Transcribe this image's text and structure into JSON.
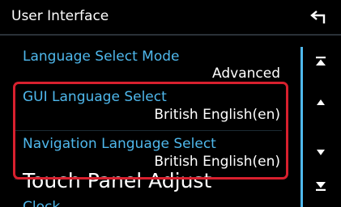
{
  "header": {
    "title": "User Interface",
    "back_icon": "return-arrow-icon"
  },
  "list": {
    "items": [
      {
        "label": "Language Select Mode",
        "value": "Advanced"
      },
      {
        "label": "GUI Language Select",
        "value": "British English(en)"
      },
      {
        "label": "Navigation Language Select",
        "value": "British English(en)"
      },
      {
        "label": "Touch Panel Adjust"
      },
      {
        "label": "Clock"
      }
    ]
  },
  "scrollbar": {
    "icons": [
      "scroll-top-icon",
      "scroll-up-icon",
      "scroll-down-icon",
      "scroll-bottom-icon"
    ]
  },
  "colors": {
    "background": "#000000",
    "accent": "#4fb8ec",
    "highlight": "#d8202e",
    "text": "#ffffff"
  }
}
